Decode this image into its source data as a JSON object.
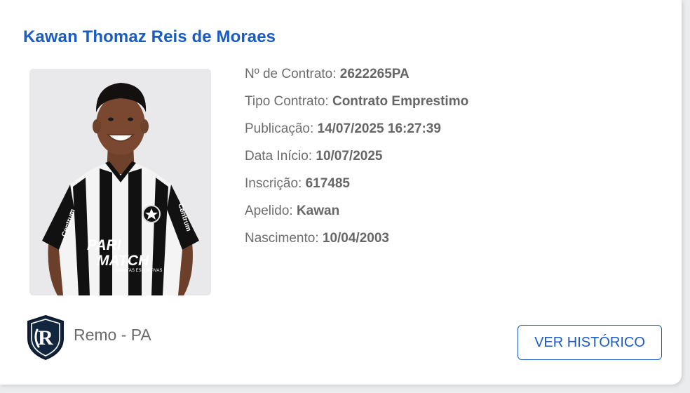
{
  "player": {
    "name": "Kawan Thomaz Reis de Moraes",
    "photo": "player-photo-icon",
    "shirt_sponsor_line1": "PARI",
    "shirt_sponsor_line2": "MATCH",
    "shirt_sponsor_sub": "APOSTAS ESPORTIVAS",
    "sleeve_sponsor": "Centrum"
  },
  "details": [
    {
      "label": "Nº de Contrato: ",
      "value": "2622265PA"
    },
    {
      "label": "Tipo Contrato: ",
      "value": "Contrato Emprestimo"
    },
    {
      "label": "Publicação: ",
      "value": "14/07/2025 16:27:39"
    },
    {
      "label": "Data Início: ",
      "value": "10/07/2025"
    },
    {
      "label": "Inscrição: ",
      "value": "617485"
    },
    {
      "label": "Apelido: ",
      "value": "Kawan"
    },
    {
      "label": "Nascimento: ",
      "value": "10/04/2003"
    }
  ],
  "club": {
    "name": "Remo - PA",
    "logo": "remo-crest-icon"
  },
  "actions": {
    "history_label": "VER HISTÓRICO"
  },
  "colors": {
    "accent": "#1a5bc4",
    "text_muted": "#6d6d6d",
    "background": "#ebecee",
    "card": "#ffffff"
  }
}
